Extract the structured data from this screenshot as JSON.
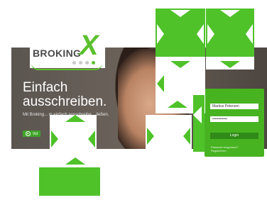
{
  "brand": {
    "name": "BROKING",
    "mark": "X"
  },
  "hero": {
    "headline_line1": "Einfach",
    "headline_line2": "ausschreiben.",
    "subline": "Mit Broking... m einfach ausschreibe... ließen.",
    "video_label": "Vid"
  },
  "login": {
    "username": "Markus Petersen",
    "password": "••••••••••••",
    "button_label": "Login",
    "forgot_label": "Passwort vergessen?",
    "register_label": "Registrieren"
  },
  "colors": {
    "accent": "#5cc02e",
    "overlay": "#4fc22a",
    "panel": "#47b321",
    "button": "#2f8a17"
  },
  "icons": [
    "play-icon",
    "arrow-icon"
  ]
}
